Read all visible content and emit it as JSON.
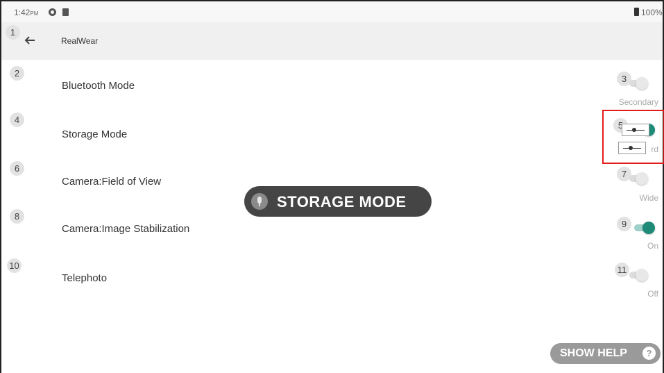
{
  "status_bar": {
    "time": "1:42",
    "ampm": "PM",
    "battery": "100%"
  },
  "app_bar": {
    "title": "RealWear"
  },
  "numbers": {
    "n1": "1",
    "n2": "2",
    "n3": "3",
    "n4": "4",
    "n5": "5",
    "n6": "6",
    "n7": "7",
    "n8": "8",
    "n9": "9",
    "n10": "10",
    "n11": "11"
  },
  "settings": [
    {
      "label": "Bluetooth Mode",
      "value": "Secondary",
      "on": false
    },
    {
      "label": "Storage Mode",
      "value": "rd",
      "on": true
    },
    {
      "label": "Camera:Field of View",
      "value": "Wide",
      "on": false
    },
    {
      "label": "Camera:Image Stabilization",
      "value": "On",
      "on": true
    },
    {
      "label": "Telephoto",
      "value": "Off",
      "on": false
    }
  ],
  "toast": {
    "text": "STORAGE MODE"
  },
  "help": {
    "label": "SHOW HELP",
    "icon_glyph": "?"
  },
  "colors": {
    "accent": "#1e8a78",
    "highlight": "#e21b1b",
    "toast_bg": "#454545"
  }
}
